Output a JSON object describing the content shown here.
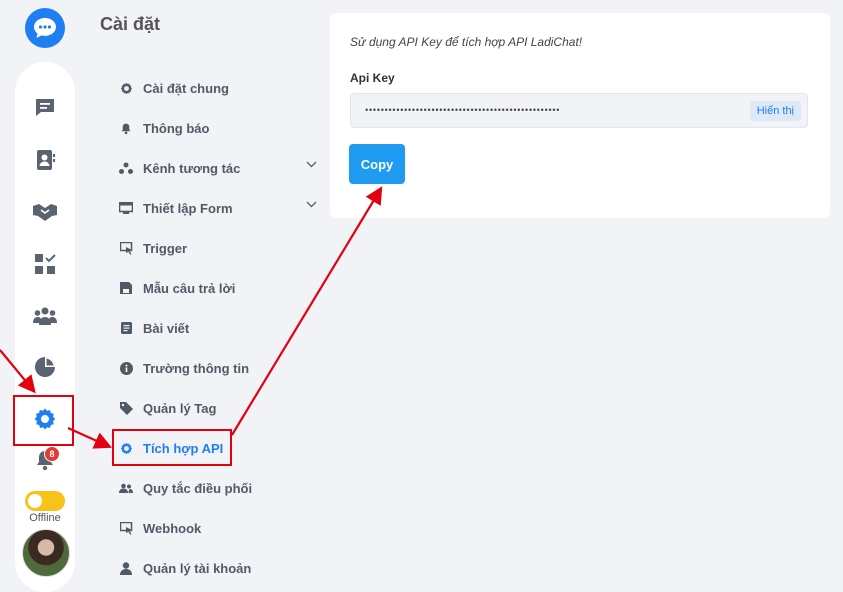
{
  "page_title": "Cài đặt",
  "rail": {
    "notification_count": "8",
    "status_label": "Offline",
    "items": [
      "chat-icon",
      "contacts-icon",
      "handshake-icon",
      "tasks-icon",
      "group-icon",
      "report-icon",
      "settings-icon",
      "bell-icon"
    ]
  },
  "menu": {
    "items": [
      {
        "label": "Cài đặt chung",
        "icon": "gear-icon"
      },
      {
        "label": "Thông báo",
        "icon": "bell-icon"
      },
      {
        "label": "Kênh tương tác",
        "icon": "share-icon",
        "expandable": true
      },
      {
        "label": "Thiết lập Form",
        "icon": "form-icon",
        "expandable": true
      },
      {
        "label": "Trigger",
        "icon": "cursor-icon"
      },
      {
        "label": "Mẫu câu trả lời",
        "icon": "save-icon"
      },
      {
        "label": "Bài viết",
        "icon": "article-icon"
      },
      {
        "label": "Trường thông tin",
        "icon": "info-icon"
      },
      {
        "label": "Quản lý Tag",
        "icon": "tag-icon"
      },
      {
        "label": "Tích hợp API",
        "icon": "gear-icon",
        "active": true
      },
      {
        "label": "Quy tắc điều phối",
        "icon": "users-icon"
      },
      {
        "label": "Webhook",
        "icon": "cursor-icon"
      },
      {
        "label": "Quản lý tài khoản",
        "icon": "user-icon"
      }
    ]
  },
  "api": {
    "hint": "Sử dụng API Key để tích hợp API LadiChat!",
    "field_label": "Api Key",
    "masked_value": "••••••••••••••••••••••••••••••••••••••••••••••••••",
    "show_label": "Hiển thị",
    "copy_label": "Copy"
  },
  "colors": {
    "accent": "#1f7ef2",
    "annotation": "#e3000f",
    "toggle": "#f6c21b"
  }
}
